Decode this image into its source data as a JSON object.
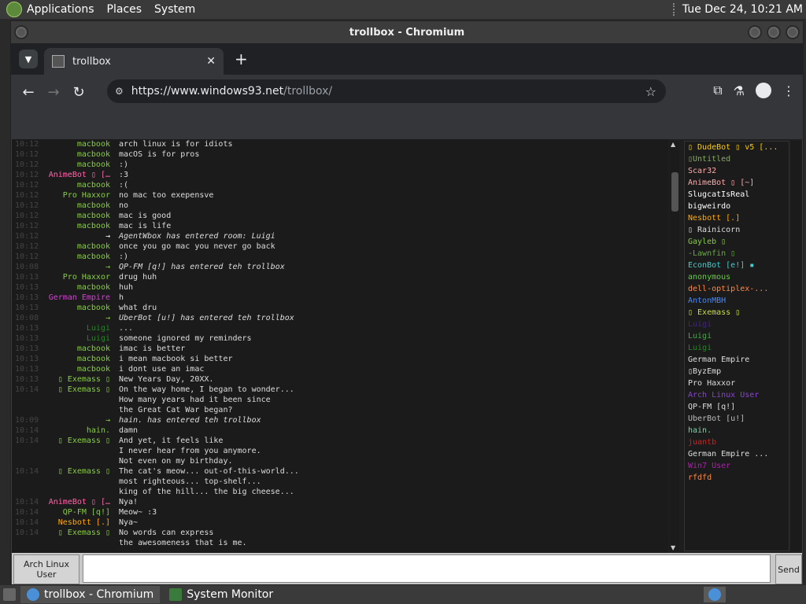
{
  "panel": {
    "menus": [
      "Applications",
      "Places",
      "System"
    ],
    "datetime": "Tue Dec 24, 10:21 AM"
  },
  "window": {
    "title": "trollbox - Chromium"
  },
  "browser": {
    "tab_label": "trollbox",
    "tab_close": "✕",
    "new_tab": "+",
    "url_domain": "https://www.windows93.net",
    "url_path": "/trollbox/"
  },
  "chat": {
    "messages": [
      {
        "time": "10:12",
        "nick": "macbook",
        "color": "#88cc44",
        "text": "arch linux is for idiots"
      },
      {
        "time": "10:12",
        "nick": "macbook",
        "color": "#88cc44",
        "text": "macOS is for pros"
      },
      {
        "time": "10:12",
        "nick": "macbook",
        "color": "#88cc44",
        "text": ":)"
      },
      {
        "time": "10:12",
        "nick": "AnimeBot ▯ […",
        "color": "#ff66aa",
        "text": ":3"
      },
      {
        "time": "10:12",
        "nick": "macbook",
        "color": "#88cc44",
        "text": ":("
      },
      {
        "time": "10:12",
        "nick": "Pro Haxxor",
        "color": "#88cc44",
        "text": "no mac too exepensve"
      },
      {
        "time": "10:12",
        "nick": "macbook",
        "color": "#88cc44",
        "text": "no"
      },
      {
        "time": "10:12",
        "nick": "macbook",
        "color": "#88cc44",
        "text": "mac is good"
      },
      {
        "time": "10:12",
        "nick": "macbook",
        "color": "#88cc44",
        "text": "mac is life"
      },
      {
        "time": "10:12",
        "nick": "→",
        "color": "#ffffff",
        "text": "AgentWbox has entered room: Luigi",
        "system": true
      },
      {
        "time": "10:12",
        "nick": "macbook",
        "color": "#88cc44",
        "text": "once you go mac you never go back"
      },
      {
        "time": "10:12",
        "nick": "macbook",
        "color": "#88cc44",
        "text": ":)"
      },
      {
        "time": "10:08",
        "nick": "→",
        "color": "#88cc44",
        "text": "QP-FM [q!] has entered teh trollbox",
        "system": true
      },
      {
        "time": "10:13",
        "nick": "Pro Haxxor",
        "color": "#88cc44",
        "text": "drug huh"
      },
      {
        "time": "10:13",
        "nick": "macbook",
        "color": "#88cc44",
        "text": "huh"
      },
      {
        "time": "10:13",
        "nick": "German Empire",
        "color": "#cc44cc",
        "text": "h"
      },
      {
        "time": "10:13",
        "nick": "macbook",
        "color": "#88cc44",
        "text": "what dru"
      },
      {
        "time": "10:08",
        "nick": "→",
        "color": "#88cc44",
        "text": "UberBot [u!] has entered teh trollbox",
        "system": true
      },
      {
        "time": "10:13",
        "nick": "Luigi",
        "color": "#228822",
        "text": "..."
      },
      {
        "time": "10:13",
        "nick": "Luigi",
        "color": "#228822",
        "text": "someone ignored my reminders"
      },
      {
        "time": "10:13",
        "nick": "macbook",
        "color": "#88cc44",
        "text": "imac is better"
      },
      {
        "time": "10:13",
        "nick": "macbook",
        "color": "#88cc44",
        "text": "i mean macbook si better"
      },
      {
        "time": "10:13",
        "nick": "macbook",
        "color": "#88cc44",
        "text": "i dont use an imac"
      },
      {
        "time": "10:13",
        "nick": "▯ Exemass ▯",
        "color": "#88cc44",
        "text": "New Years Day, 20XX."
      },
      {
        "time": "10:14",
        "nick": "▯ Exemass ▯",
        "color": "#88cc44",
        "text": "On the way home, I began to wonder..."
      },
      {
        "time": "",
        "nick": "",
        "color": "#88cc44",
        "text": "How many years had it been since"
      },
      {
        "time": "",
        "nick": "",
        "color": "#88cc44",
        "text": "the Great Cat War began?"
      },
      {
        "time": "10:09",
        "nick": "→",
        "color": "#88cc44",
        "text": "hain. has entered teh trollbox",
        "system": true
      },
      {
        "time": "10:14",
        "nick": "hain.",
        "color": "#88cc44",
        "text": "damn"
      },
      {
        "time": "10:14",
        "nick": "▯ Exemass ▯",
        "color": "#88cc44",
        "text": "And yet, it feels like"
      },
      {
        "time": "",
        "nick": "",
        "color": "#88cc44",
        "text": "I never hear from you anymore."
      },
      {
        "time": "",
        "nick": "",
        "color": "#88cc44",
        "text": "Not even on my birthday."
      },
      {
        "time": "10:14",
        "nick": "▯ Exemass ▯",
        "color": "#88cc44",
        "text": "The cat's meow... out-of-this-world..."
      },
      {
        "time": "",
        "nick": "",
        "color": "#88cc44",
        "text": "most righteous... top-shelf..."
      },
      {
        "time": "",
        "nick": "",
        "color": "#88cc44",
        "text": "king of the hill... the big cheese..."
      },
      {
        "time": "10:14",
        "nick": "AnimeBot ▯ […",
        "color": "#ff66aa",
        "text": "Nya!"
      },
      {
        "time": "10:14",
        "nick": "QP-FM [q!]",
        "color": "#88cc44",
        "text": "Meow~ :3"
      },
      {
        "time": "10:14",
        "nick": "Nesbott [.]",
        "color": "#ffaa00",
        "text": "Nya~"
      },
      {
        "time": "10:14",
        "nick": "▯ Exemass ▯",
        "color": "#88cc44",
        "text": "No words can express"
      },
      {
        "time": "",
        "nick": "",
        "color": "#88cc44",
        "text": "the awesomeness that is me."
      }
    ]
  },
  "users": [
    {
      "name": "▯ DudeBot ▯ v5 [...",
      "color": "#ffcc00"
    },
    {
      "name": "▯Untitled",
      "color": "#88aa66"
    },
    {
      "name": "Scar32",
      "color": "#ffaaaa"
    },
    {
      "name": "AnimeBot ▯ [~]",
      "color": "#ffaaaa"
    },
    {
      "name": "SlugcatIsReal",
      "color": "#ffffff"
    },
    {
      "name": "bigweirdo",
      "color": "#ffffff"
    },
    {
      "name": "Nesbott [.]",
      "color": "#ffaa00"
    },
    {
      "name": "▯ Rainicorn",
      "color": "#dddddd"
    },
    {
      "name": "Gayleb ▯",
      "color": "#88cc44"
    },
    {
      "name": "-Lawnfin ▯",
      "color": "#66aa44"
    },
    {
      "name": "EconBot [e!] ▪",
      "color": "#44cccc"
    },
    {
      "name": "anonymous",
      "color": "#66cc44"
    },
    {
      "name": "dell-optiplex-...",
      "color": "#ff8844"
    },
    {
      "name": "AntonMBH",
      "color": "#4488ff"
    },
    {
      "name": "▯ Exemass ▯",
      "color": "#ccdd44"
    },
    {
      "name": "Luigi",
      "color": "#442288"
    },
    {
      "name": "Luigi",
      "color": "#44aa44"
    },
    {
      "name": "Luigi",
      "color": "#228822"
    },
    {
      "name": "German Empire",
      "color": "#dddddd"
    },
    {
      "name": "▯ByzEmp",
      "color": "#dddddd"
    },
    {
      "name": "Pro Haxxor",
      "color": "#dddddd"
    },
    {
      "name": "Arch Linux User",
      "color": "#8844cc"
    },
    {
      "name": "QP-FM [q!]",
      "color": "#dddddd"
    },
    {
      "name": "UberBot [u!]",
      "color": "#bbbbbb"
    },
    {
      "name": "hain.",
      "color": "#88ccaa"
    },
    {
      "name": "juantb",
      "color": "#cc2222"
    },
    {
      "name": "German Empire ...",
      "color": "#dddddd"
    },
    {
      "name": "Win7 User",
      "color": "#aa22aa"
    },
    {
      "name": "rfdfd",
      "color": "#ff8844"
    }
  ],
  "input": {
    "user_label": "Arch Linux User",
    "message_value": "",
    "send_label": "Send"
  },
  "taskbar": {
    "tasks": [
      "trollbox - Chromium",
      "System Monitor"
    ]
  }
}
